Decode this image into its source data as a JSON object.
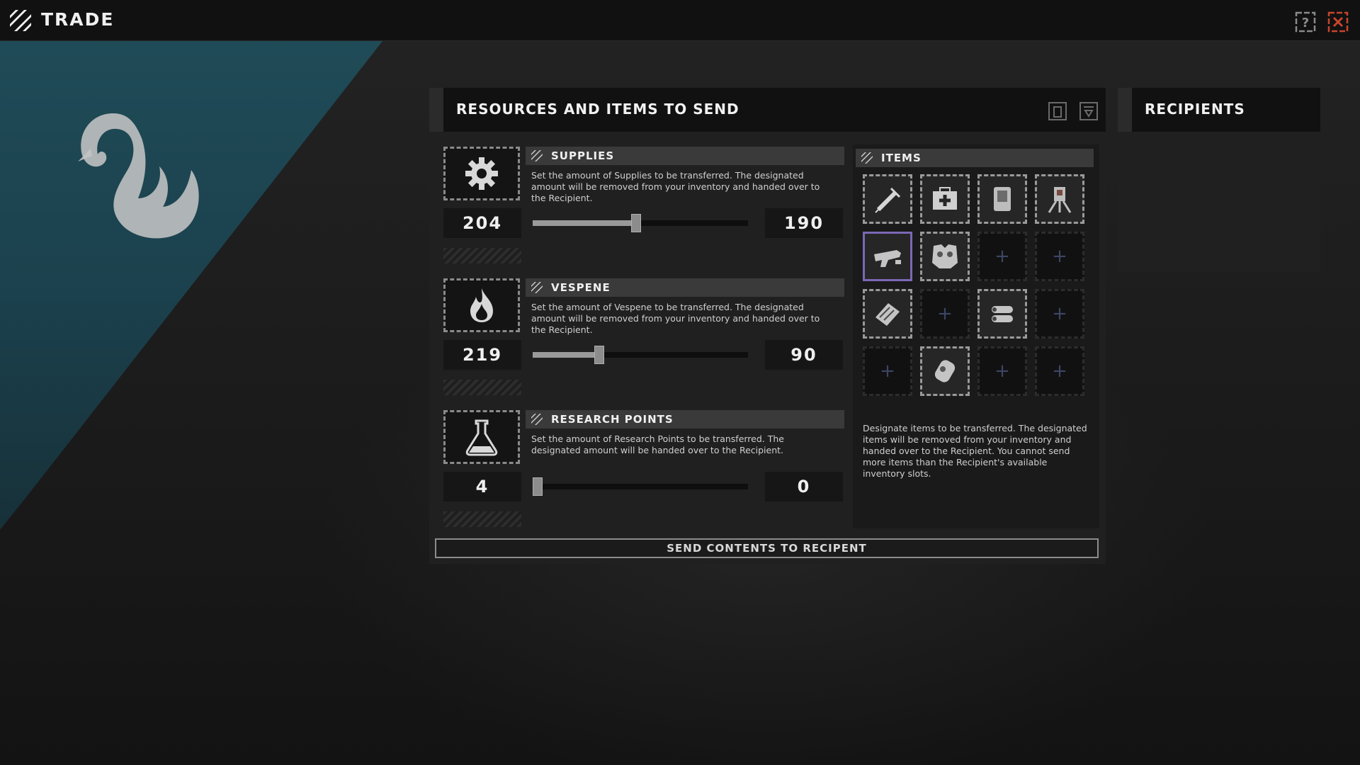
{
  "topbar": {
    "title": "TRADE",
    "logo_icon": "stripes-logo-icon",
    "help_icon": "help-icon",
    "close_icon": "close-icon",
    "close_color": "#c8452c"
  },
  "send_panel": {
    "title": "RESOURCES AND ITEMS TO SEND",
    "header_icons": [
      "copy-icon",
      "filter-icon"
    ],
    "resources": [
      {
        "name": "SUPPLIES",
        "icon": "gear-icon",
        "description": "Set the amount of Supplies to be transferred. The designated amount will be removed from your inventory and handed over to the Recipient.",
        "owned": "204",
        "send_amount": "190",
        "slider_fraction": 0.48
      },
      {
        "name": "VESPENE",
        "icon": "flame-icon",
        "description": "Set the amount of Vespene to be transferred. The designated amount will be removed from your inventory and handed over to the Recipient.",
        "owned": "219",
        "send_amount": "90",
        "slider_fraction": 0.3
      },
      {
        "name": "RESEARCH POINTS",
        "icon": "flask-icon",
        "description": "Set the amount of Research Points to be transferred. The designated amount will be handed over to the Recipient.",
        "owned": "4",
        "send_amount": "0",
        "slider_fraction": 0.0
      }
    ],
    "items": {
      "title": "ITEMS",
      "slots": [
        {
          "state": "filled",
          "icon": "syringe-icon"
        },
        {
          "state": "filled",
          "icon": "medkit-icon"
        },
        {
          "state": "filled",
          "icon": "armor-plate-icon"
        },
        {
          "state": "filled",
          "icon": "turret-icon"
        },
        {
          "state": "filled",
          "icon": "rifle-icon",
          "selected": true
        },
        {
          "state": "filled",
          "icon": "chest-armor-icon"
        },
        {
          "state": "empty",
          "icon": "plus-icon"
        },
        {
          "state": "empty",
          "icon": "plus-icon"
        },
        {
          "state": "filled",
          "icon": "ammo-clip-icon"
        },
        {
          "state": "empty",
          "icon": "plus-icon"
        },
        {
          "state": "filled",
          "icon": "barrels-icon"
        },
        {
          "state": "empty",
          "icon": "plus-icon"
        },
        {
          "state": "empty",
          "icon": "plus-icon"
        },
        {
          "state": "filled",
          "icon": "canister-icon"
        },
        {
          "state": "empty",
          "icon": "plus-icon"
        },
        {
          "state": "empty",
          "icon": "plus-icon"
        }
      ],
      "description": "Designate items to be transferred. The designated items will be removed from your inventory and handed over to the Recipient. You cannot send more items than the Recipient's available inventory slots.",
      "selected_color": "#7b68b5"
    },
    "send_button": "SEND CONTENTS TO RECIPENT"
  },
  "recipients": {
    "title": "RECIPIENTS"
  },
  "emblem": "swan-emblem-icon",
  "accent_teal": "#1f4d5a"
}
